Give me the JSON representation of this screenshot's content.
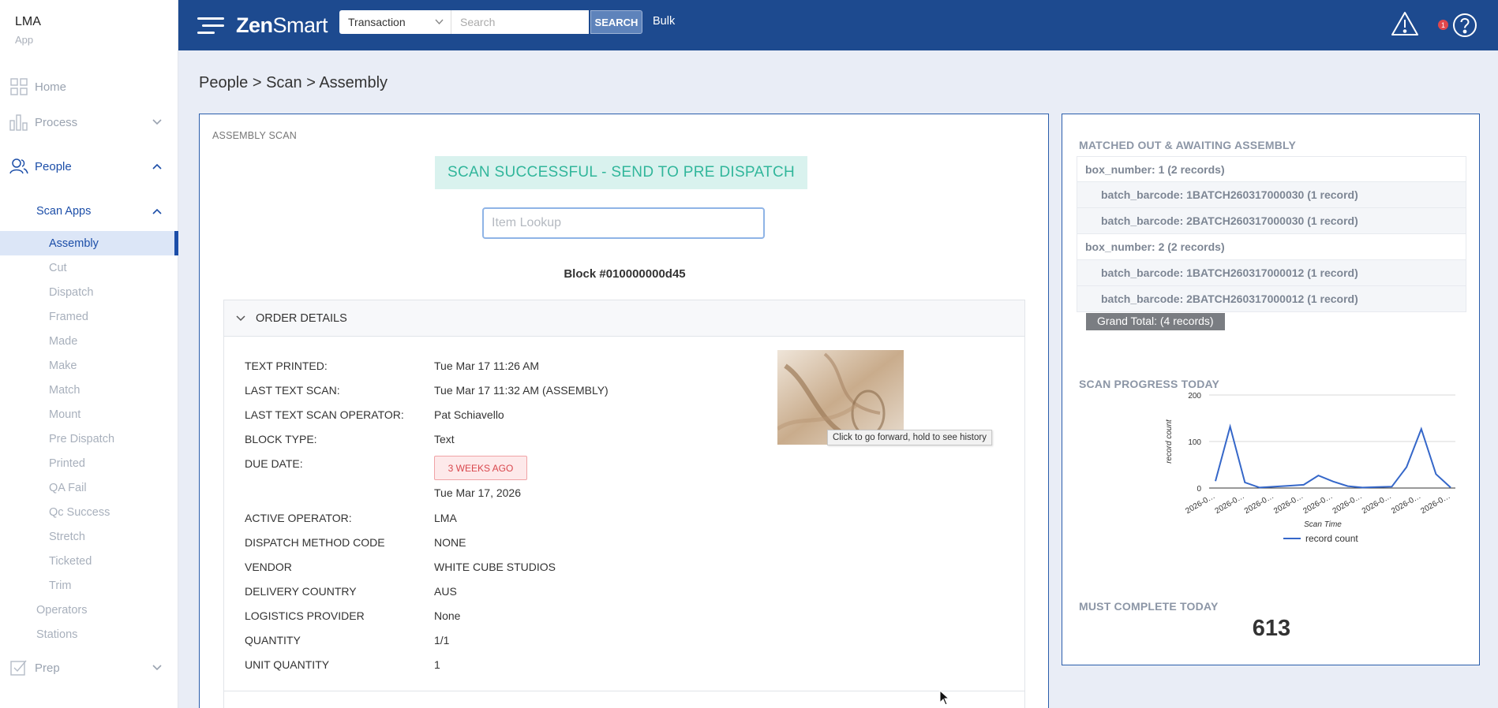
{
  "app": {
    "name": "LMA",
    "sub": "App"
  },
  "sidebar": {
    "home": "Home",
    "process": "Process",
    "people": "People",
    "scan_apps": "Scan Apps",
    "scan_items": [
      "Assembly",
      "Cut",
      "Dispatch",
      "Framed",
      "Made",
      "Make",
      "Match",
      "Mount",
      "Pre Dispatch",
      "Printed",
      "QA Fail",
      "Qc Success",
      "Stretch",
      "Ticketed",
      "Trim"
    ],
    "operators": "Operators",
    "stations": "Stations",
    "prep": "Prep"
  },
  "topbar": {
    "logo_bold": "Zen",
    "logo_rest": "Smart",
    "search_type": "Transaction",
    "search_placeholder": "Search",
    "search_button": "SEARCH",
    "bulk": "Bulk",
    "notification_count": "1"
  },
  "breadcrumb": "People > Scan > Assembly",
  "main": {
    "card_label": "ASSEMBLY SCAN",
    "scan_status": "SCAN SUCCESSFUL - SEND TO PRE DISPATCH",
    "lookup_placeholder": "Item Lookup",
    "block_number": "Block #010000000d45",
    "order_details_title": "ORDER DETAILS",
    "details": [
      {
        "label": "TEXT PRINTED:",
        "value": "Tue Mar 17 11:26 AM"
      },
      {
        "label": "LAST TEXT SCAN:",
        "value": "Tue Mar 17 11:32 AM (ASSEMBLY)"
      },
      {
        "label": "LAST TEXT SCAN OPERATOR:",
        "value": "Pat Schiavello"
      },
      {
        "label": "BLOCK TYPE:",
        "value": "Text"
      },
      {
        "label": "DUE DATE:",
        "value": "Tue Mar 17, 2026"
      },
      {
        "label": "ACTIVE OPERATOR:",
        "value": "LMA"
      },
      {
        "label": "DISPATCH METHOD CODE",
        "value": "NONE"
      },
      {
        "label": "VENDOR",
        "value": "WHITE CUBE STUDIOS"
      },
      {
        "label": "DELIVERY COUNTRY",
        "value": "AUS"
      },
      {
        "label": "LOGISTICS PROVIDER",
        "value": "None"
      },
      {
        "label": "QUANTITY",
        "value": "1/1"
      },
      {
        "label": "UNIT QUANTITY",
        "value": "1"
      }
    ],
    "due_badge": "3 WEEKS AGO",
    "thumbnail_tooltip": "Click to go forward, hold to see history"
  },
  "side": {
    "matched_title": "MATCHED OUT & AWAITING ASSEMBLY",
    "pivot_rows": [
      {
        "level": 1,
        "text": "box_number: 1 (2 records)"
      },
      {
        "level": 2,
        "text": "batch_barcode: 1BATCH260317000030 (1 record)"
      },
      {
        "level": 2,
        "text": "batch_barcode: 2BATCH260317000030 (1 record)"
      },
      {
        "level": 1,
        "text": "box_number: 2 (2 records)"
      },
      {
        "level": 2,
        "text": "batch_barcode: 1BATCH260317000012 (1 record)"
      },
      {
        "level": 2,
        "text": "batch_barcode: 2BATCH260317000012 (1 record)"
      }
    ],
    "grand_total": "Grand Total: (4 records)",
    "progress_title": "SCAN PROGRESS TODAY",
    "must_title": "MUST COMPLETE TODAY",
    "must_value": "613"
  },
  "chart_data": {
    "type": "line",
    "xlabel": "Scan Time",
    "ylabel": "record count",
    "ylim": [
      0,
      200
    ],
    "yticks": [
      0,
      100,
      200
    ],
    "x_tick_labels": [
      "2026-0…",
      "2026-0…",
      "2026-0…",
      "2026-0…",
      "2026-0…",
      "2026-0…",
      "2026-0…",
      "2026-0…",
      "2026-0…"
    ],
    "series": [
      {
        "name": "record count",
        "color": "#3567c9",
        "values": [
          15,
          132,
          12,
          1,
          3,
          5,
          7,
          27,
          14,
          4,
          1,
          2,
          3,
          45,
          127,
          30,
          1
        ]
      }
    ],
    "grid": true,
    "legend": "bottom"
  },
  "colors": {
    "topbar": "#1d4a8f",
    "accent": "#1c4ea8",
    "success_bg": "#d9f2ee",
    "success_text": "#31b69b",
    "danger": "#d9474d",
    "line": "#3567c9"
  }
}
